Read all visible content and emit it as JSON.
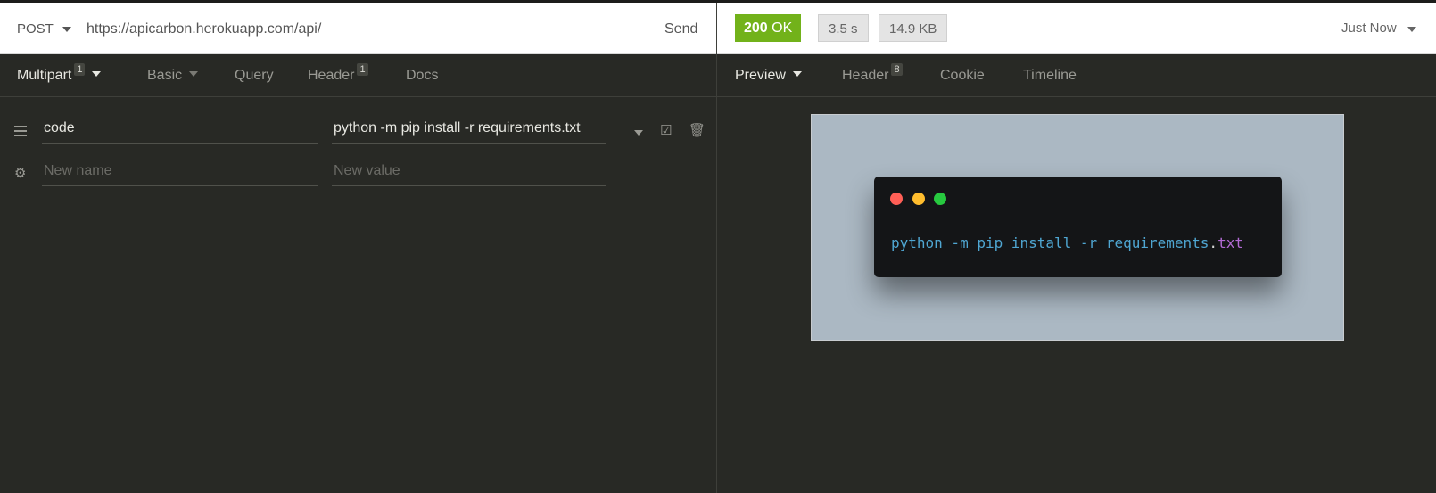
{
  "request": {
    "method": "POST",
    "url": "https://apicarbon.herokuapp.com/api/",
    "send_label": "Send"
  },
  "request_tabs": [
    {
      "label": "Multipart",
      "badge": "1"
    },
    {
      "label": "Basic"
    },
    {
      "label": "Query"
    },
    {
      "label": "Header",
      "badge": "1"
    },
    {
      "label": "Docs"
    }
  ],
  "params": {
    "name": "code",
    "value": "python -m pip install -r requirements.txt",
    "new_name_placeholder": "New name",
    "new_value_placeholder": "New value"
  },
  "response": {
    "status_code": "200",
    "status_text": "OK",
    "time": "3.5 s",
    "size": "14.9 KB",
    "history_label": "Just Now",
    "status_color": "#72b21a"
  },
  "response_tabs": [
    {
      "label": "Preview"
    },
    {
      "label": "Header",
      "badge": "8"
    },
    {
      "label": "Cookie"
    },
    {
      "label": "Timeline"
    }
  ],
  "preview": {
    "code_main": "python -m pip install -r requirements",
    "code_dot": ".",
    "code_ext": "txt",
    "window_dots": [
      "#ff5f56",
      "#ffbd2e",
      "#27c93f"
    ],
    "background_color": "#abb8c3"
  }
}
